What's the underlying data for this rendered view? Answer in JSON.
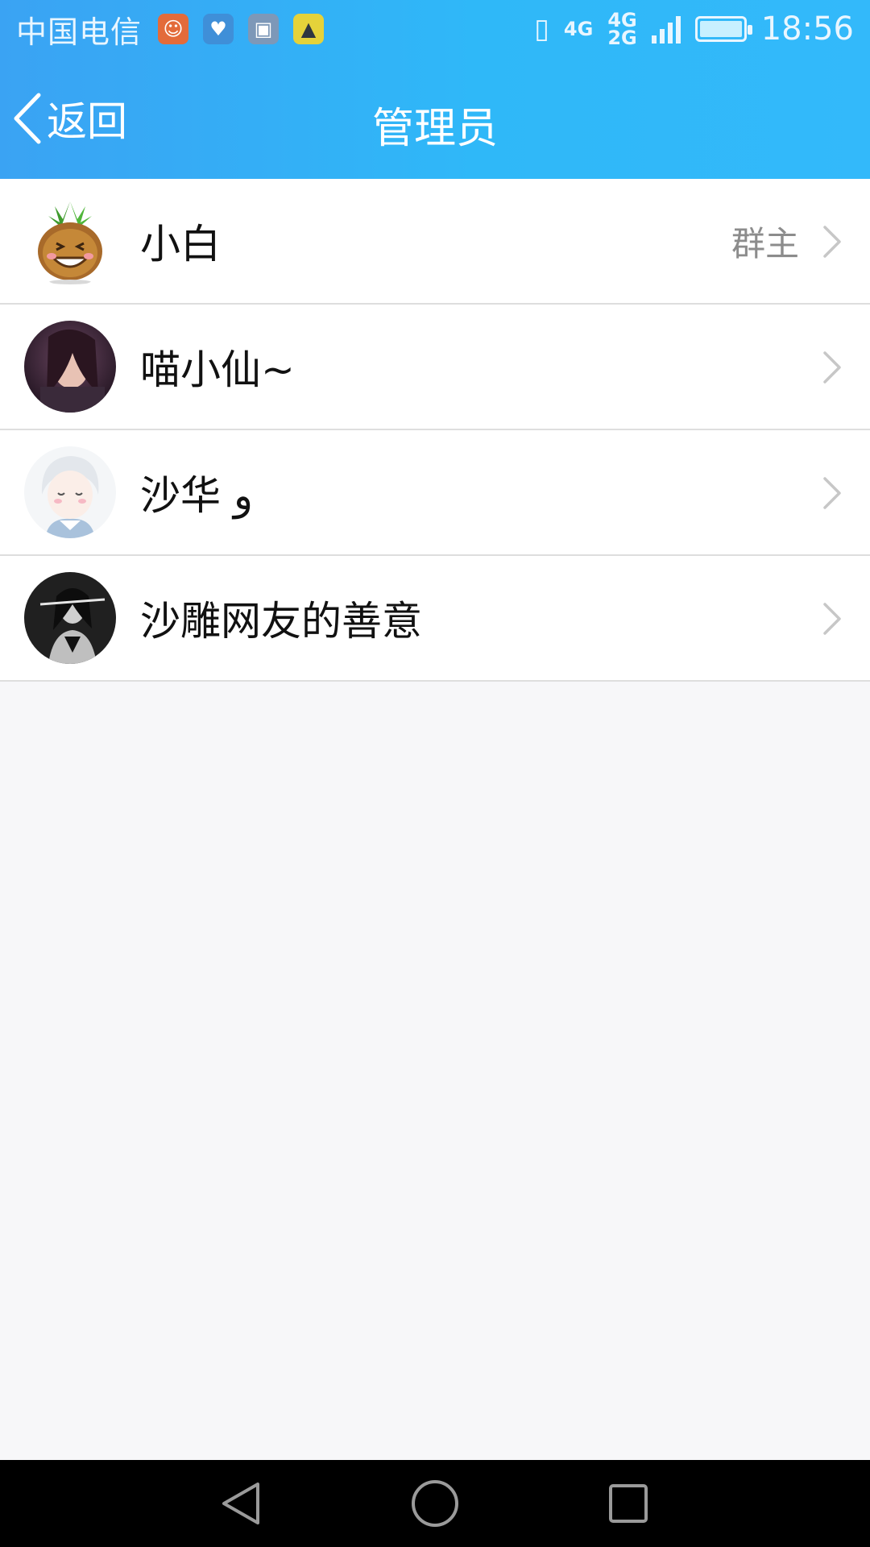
{
  "status_bar": {
    "carrier": "中国电信",
    "notification_icons": [
      "app-face-icon",
      "health-icon",
      "gallery-icon",
      "tent-icon"
    ],
    "network_primary": "4G",
    "network_secondary_top": "4G",
    "network_secondary_bottom": "2G",
    "time": "18:56"
  },
  "nav": {
    "back_label": "返回",
    "title": "管理员"
  },
  "admins": [
    {
      "name": "小白",
      "role": "群主",
      "avatar": "pineapple-cartoon-avatar"
    },
    {
      "name": "喵小仙~",
      "role": "",
      "avatar": "girl-photo-avatar"
    },
    {
      "name": "沙华 و",
      "role": "",
      "avatar": "anime-boy-avatar"
    },
    {
      "name": "沙雕网友的善意",
      "role": "",
      "avatar": "bw-photo-avatar"
    }
  ],
  "colors": {
    "header_start": "#3aa3f3",
    "header_end": "#33b9fa",
    "background": "#f7f7f9",
    "role_text": "#8c8c8c"
  }
}
